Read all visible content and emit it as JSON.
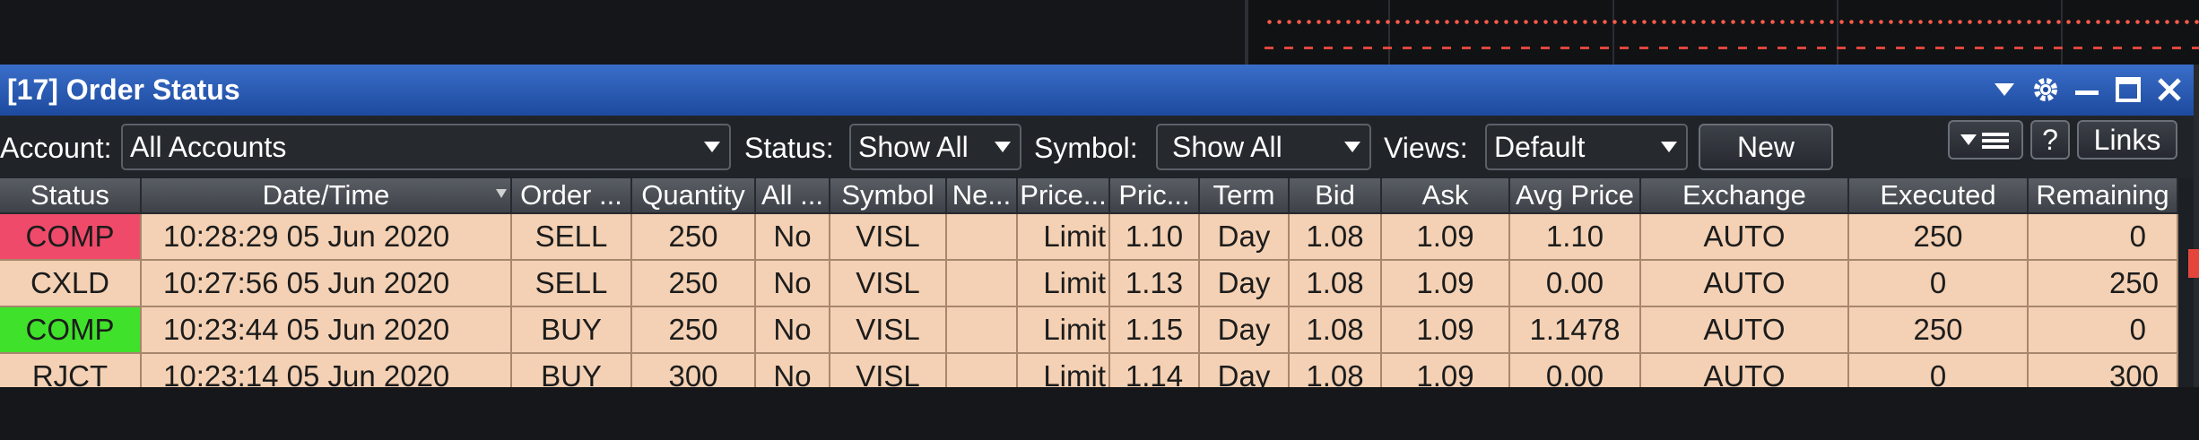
{
  "window": {
    "title": "[17] Order Status",
    "icons": [
      "menu-arrow-icon",
      "gear-icon",
      "minimize-icon",
      "maximize-icon",
      "close-icon"
    ]
  },
  "toolbar": {
    "account_label": "Account:",
    "account_value": "All Accounts",
    "status_label": "Status:",
    "status_value": "Show All",
    "symbol_label": "Symbol:",
    "symbol_value": "Show All",
    "views_label": "Views:",
    "views_value": "Default",
    "new_button": "New",
    "help_button": "?",
    "links_button": "Links"
  },
  "table": {
    "columns": [
      "Status",
      "Date/Time",
      "Order ...",
      "Quantity",
      "All ...",
      "Symbol",
      "Ne...",
      "Price...",
      "Pric...",
      "Term",
      "Bid",
      "Ask",
      "Avg Price",
      "Exchange",
      "Executed",
      "Remaining"
    ],
    "rows": [
      {
        "status": "COMP",
        "status_color": "#ef4a6a",
        "datetime": "10:28:29 05 Jun 2020",
        "order": "SELL",
        "quantity": "250",
        "all": "No",
        "symbol": "VISL",
        "ne": "",
        "price_type": "Limit",
        "price": "1.10",
        "term": "Day",
        "bid": "1.08",
        "ask": "1.09",
        "avg_price": "1.10",
        "exchange": "AUTO",
        "executed": "250",
        "remaining": "0"
      },
      {
        "status": "CXLD",
        "status_color": "",
        "datetime": "10:27:56 05 Jun 2020",
        "order": "SELL",
        "quantity": "250",
        "all": "No",
        "symbol": "VISL",
        "ne": "",
        "price_type": "Limit",
        "price": "1.13",
        "term": "Day",
        "bid": "1.08",
        "ask": "1.09",
        "avg_price": "0.00",
        "exchange": "AUTO",
        "executed": "0",
        "remaining": "250"
      },
      {
        "status": "COMP",
        "status_color": "#3fe12a",
        "datetime": "10:23:44 05 Jun 2020",
        "order": "BUY",
        "quantity": "250",
        "all": "No",
        "symbol": "VISL",
        "ne": "",
        "price_type": "Limit",
        "price": "1.15",
        "term": "Day",
        "bid": "1.08",
        "ask": "1.09",
        "avg_price": "1.1478",
        "exchange": "AUTO",
        "executed": "250",
        "remaining": "0"
      },
      {
        "status": "RJCT",
        "status_color": "",
        "datetime": "10:23:14 05 Jun 2020",
        "order": "BUY",
        "quantity": "300",
        "all": "No",
        "symbol": "VISL",
        "ne": "",
        "price_type": "Limit",
        "price": "1.14",
        "term": "Day",
        "bid": "1.08",
        "ask": "1.09",
        "avg_price": "0.00",
        "exchange": "AUTO",
        "executed": "0",
        "remaining": "300"
      }
    ]
  },
  "colors": {
    "title_bar": "#2d5fb8",
    "row_background": "#f4d1b4",
    "header_background": "#4a4e55",
    "chart_dots": "#ff5a4a"
  }
}
